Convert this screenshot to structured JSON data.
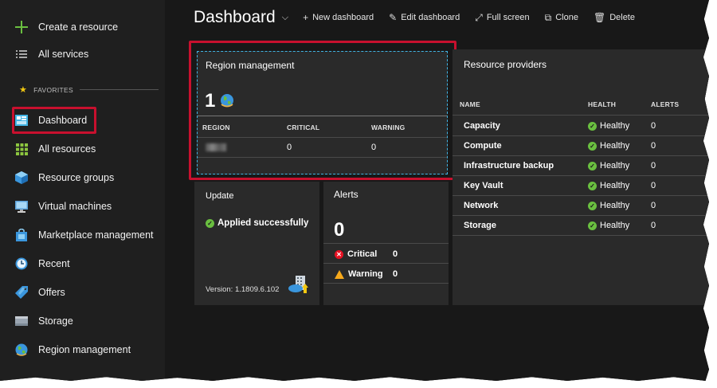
{
  "sidebar": {
    "create_resource": "Create a resource",
    "all_services": "All services",
    "favorites_label": "FAVORITES",
    "items": [
      {
        "label": "Dashboard",
        "icon": "dashboard-icon"
      },
      {
        "label": "All resources",
        "icon": "grid-icon"
      },
      {
        "label": "Resource groups",
        "icon": "cube-icon"
      },
      {
        "label": "Virtual machines",
        "icon": "monitor-icon"
      },
      {
        "label": "Marketplace management",
        "icon": "shopping-bag-icon"
      },
      {
        "label": "Recent",
        "icon": "clock-icon"
      },
      {
        "label": "Offers",
        "icon": "tag-icon"
      },
      {
        "label": "Storage",
        "icon": "storage-icon"
      },
      {
        "label": "Region management",
        "icon": "globe-icon"
      }
    ]
  },
  "toolbar": {
    "title": "Dashboard",
    "new_dashboard": "New dashboard",
    "edit_dashboard": "Edit dashboard",
    "full_screen": "Full screen",
    "clone": "Clone",
    "delete": "Delete"
  },
  "region_tile": {
    "title": "Region management",
    "count": "1",
    "headers": [
      "REGION",
      "CRITICAL",
      "WARNING"
    ],
    "row": {
      "critical": "0",
      "warning": "0"
    }
  },
  "update_tile": {
    "title": "Update",
    "status": "Applied successfully",
    "version": "Version: 1.1809.6.102"
  },
  "alerts_tile": {
    "title": "Alerts",
    "count": "0",
    "critical_label": "Critical",
    "critical_value": "0",
    "warning_label": "Warning",
    "warning_value": "0"
  },
  "providers_tile": {
    "title": "Resource providers",
    "headers": [
      "NAME",
      "HEALTH",
      "ALERTS"
    ],
    "rows": [
      {
        "name": "Capacity",
        "health": "Healthy",
        "alerts": "0"
      },
      {
        "name": "Compute",
        "health": "Healthy",
        "alerts": "0"
      },
      {
        "name": "Infrastructure backup",
        "health": "Healthy",
        "alerts": "0"
      },
      {
        "name": "Key Vault",
        "health": "Healthy",
        "alerts": "0"
      },
      {
        "name": "Network",
        "health": "Healthy",
        "alerts": "0"
      },
      {
        "name": "Storage",
        "health": "Healthy",
        "alerts": "0"
      }
    ]
  },
  "colors": {
    "accent": "#41b4e4",
    "highlight": "#c8102e",
    "healthy": "#6abf40",
    "critical": "#e81123",
    "warning": "#f7a91b"
  }
}
